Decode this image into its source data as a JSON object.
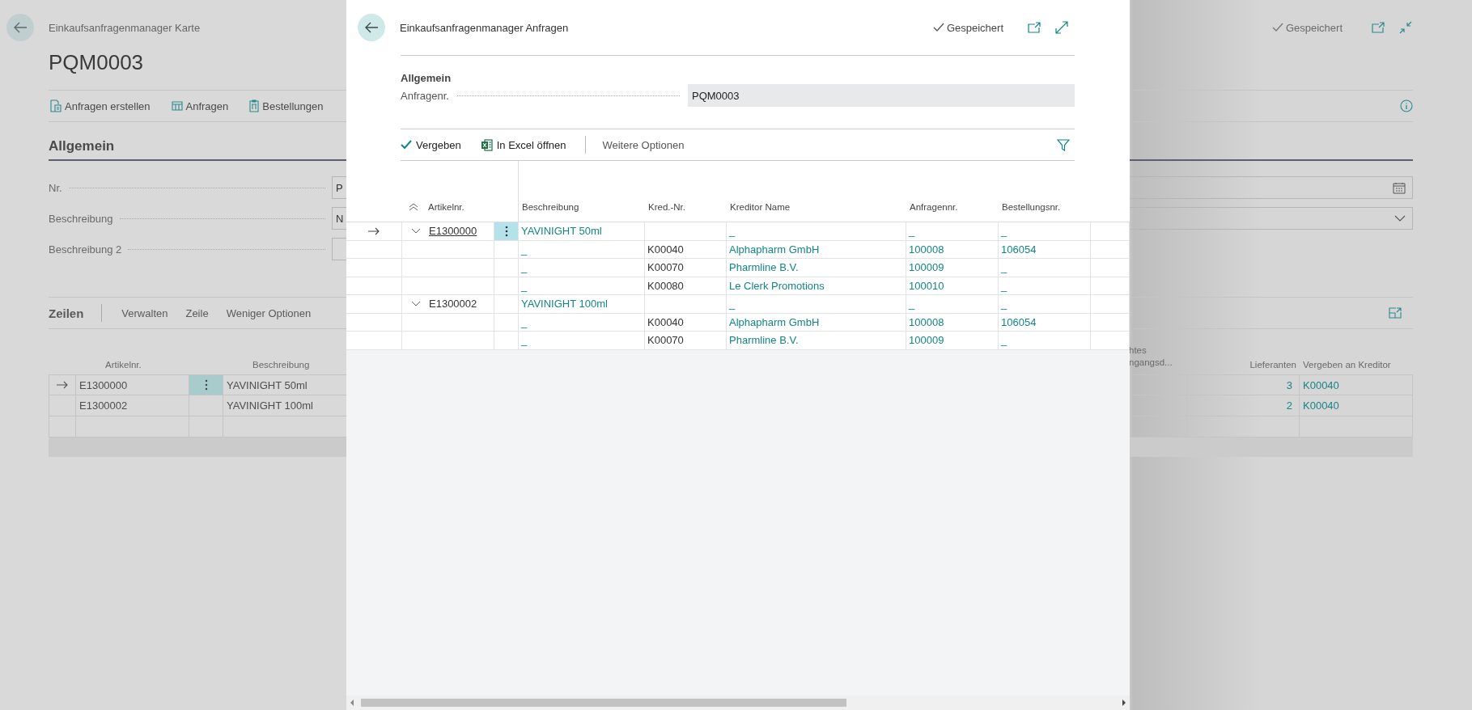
{
  "page": {
    "breadcrumb": "Einkaufsanfragenmanager Karte",
    "title": "PQM0003",
    "status": "Gespeichert",
    "actions": [
      {
        "label": "Anfragen erstellen",
        "kind": "create"
      },
      {
        "label": "Anfragen",
        "kind": "list"
      },
      {
        "label": "Bestellungen",
        "kind": "orders"
      }
    ],
    "section": "Allgemein",
    "fields": [
      {
        "label": "Nr.",
        "value": "P",
        "kind": "date"
      },
      {
        "label": "Beschreibung",
        "value": "N",
        "kind": "dropdown"
      },
      {
        "label": "Beschreibung 2",
        "kind": "text"
      }
    ],
    "lines": {
      "title": "Zeilen",
      "actions": [
        "Verwalten",
        "Zeile",
        "Weniger Optionen"
      ],
      "columns": {
        "artikelnr": "Artikelnr.",
        "beschreibung": "Beschreibung",
        "column_3": "htes ngangsd...",
        "lieferanten": "Lieferanten",
        "vergeben": "Vergeben an Kreditor"
      },
      "rows": [
        {
          "artikelnr": "E1300000",
          "beschreibung": "YAVINIGHT 50ml",
          "lieferanten": "3",
          "vergeben": "K00040",
          "selected": true
        },
        {
          "artikelnr": "E1300002",
          "beschreibung": "YAVINIGHT 100ml",
          "lieferanten": "2",
          "vergeben": "K00040",
          "selected": false
        }
      ]
    }
  },
  "dialog": {
    "breadcrumb": "Einkaufsanfragenmanager Anfragen",
    "status": "Gespeichert",
    "section": "Allgemein",
    "field": {
      "label": "Anfragenr.",
      "value": "PQM0003"
    },
    "actions": [
      {
        "label": "Vergeben",
        "kind": "assign"
      },
      {
        "label": "In Excel öffnen",
        "kind": "excel"
      },
      {
        "label": "Weitere Optionen",
        "kind": "more"
      }
    ],
    "table": {
      "columns": {
        "artikelnr": "Artikelnr.",
        "beschreibung": "Beschreibung",
        "kred_nr": "Kred.-Nr.",
        "kreditor_name": "Kreditor Name",
        "anfragennr": "Anfragennr.",
        "bestellungsnr": "Bestellungsnr."
      },
      "rows": [
        {
          "artikelnr": "E1300000",
          "beschreibung": "YAVINIGHT 50ml",
          "kreditor_name": "_",
          "anfragennr": "_",
          "bestellungsnr": "_",
          "expanded": true,
          "selected": true,
          "children": [
            {
              "beschreibung": "_",
              "kred_nr": "K00040",
              "kreditor_name": "Alphapharm GmbH",
              "anfragennr": "100008",
              "bestellungsnr": "106054"
            },
            {
              "beschreibung": "_",
              "kred_nr": "K00070",
              "kreditor_name": "Pharmline B.V.",
              "anfragennr": "100009",
              "bestellungsnr": "_"
            },
            {
              "beschreibung": "_",
              "kred_nr": "K00080",
              "kreditor_name": "Le Clerk Promotions",
              "anfragennr": "100010",
              "bestellungsnr": "_"
            }
          ]
        },
        {
          "artikelnr": "E1300002",
          "beschreibung": "YAVINIGHT 100ml",
          "kreditor_name": "_",
          "anfragennr": "_",
          "bestellungsnr": "_",
          "expanded": true,
          "selected": false,
          "children": [
            {
              "beschreibung": "_",
              "kred_nr": "K00040",
              "kreditor_name": "Alphapharm GmbH",
              "anfragennr": "100008",
              "bestellungsnr": "106054"
            },
            {
              "beschreibung": "_",
              "kred_nr": "K00070",
              "kreditor_name": "Pharmline B.V.",
              "anfragennr": "100009",
              "bestellungsnr": "_"
            }
          ]
        }
      ]
    }
  }
}
